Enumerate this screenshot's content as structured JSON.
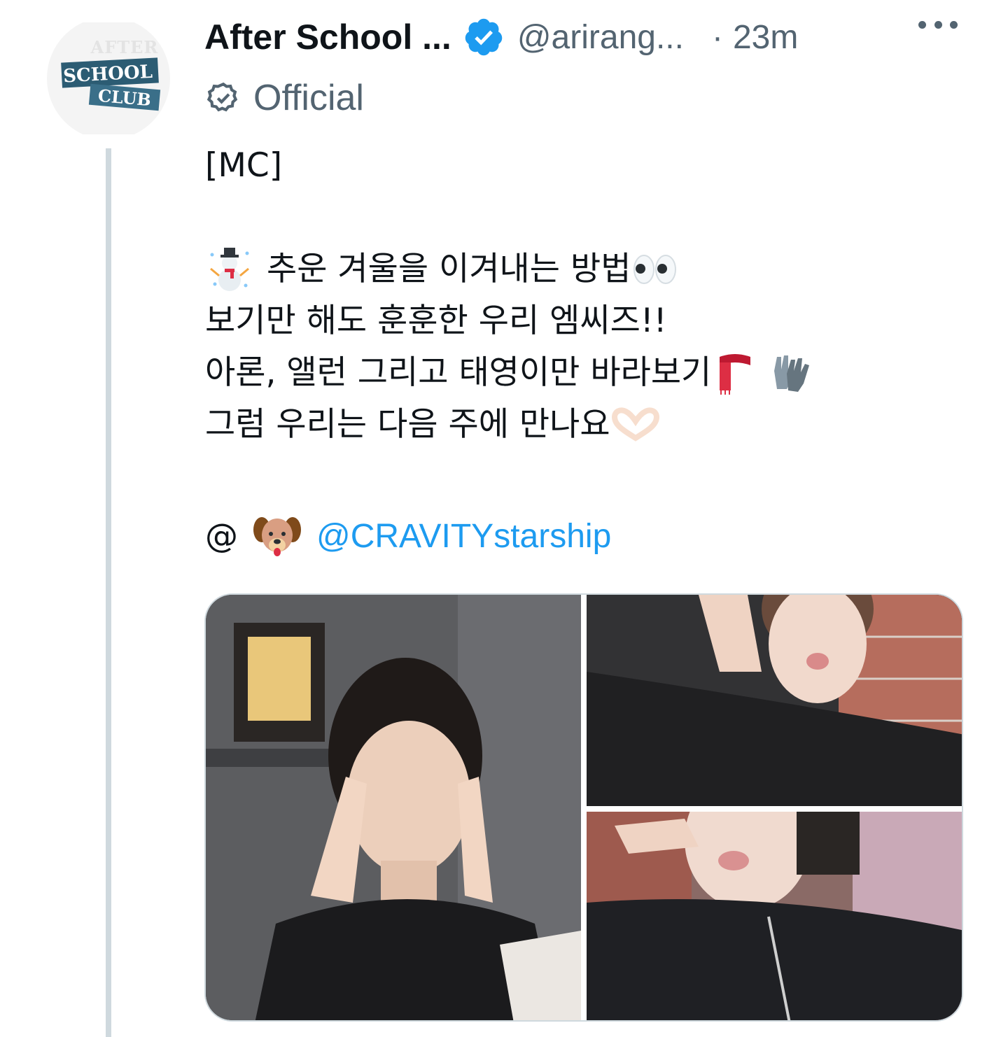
{
  "account": {
    "display_name": "After School ...",
    "handle": "@arirang...",
    "separator": "·",
    "time": "23m",
    "official_label": "Official",
    "avatar_lines": [
      "AFTER",
      "SCHOOL",
      "CLUB"
    ]
  },
  "tweet": {
    "line1": "[MC]",
    "line2": "추운 겨울을 이겨내는 방법",
    "line3": "보기만 해도 훈훈한 우리 엠씨즈!!",
    "line4": "아론, 앨런 그리고 태영이만 바라보기",
    "line5": "그럼 우리는 다음 주에 만나요",
    "mention_prefix": "@",
    "mention": "@CRAVITYstarship"
  },
  "emojis": [
    "snowman-icon",
    "eyes-icon",
    "scarf-icon",
    "gloves-icon",
    "heart-hands-icon",
    "dog-face-icon"
  ],
  "colors": {
    "link": "#1d9bf0",
    "verified": "#1d9bf0",
    "secondary_text": "#536471",
    "thread_line": "#cfd9de"
  }
}
